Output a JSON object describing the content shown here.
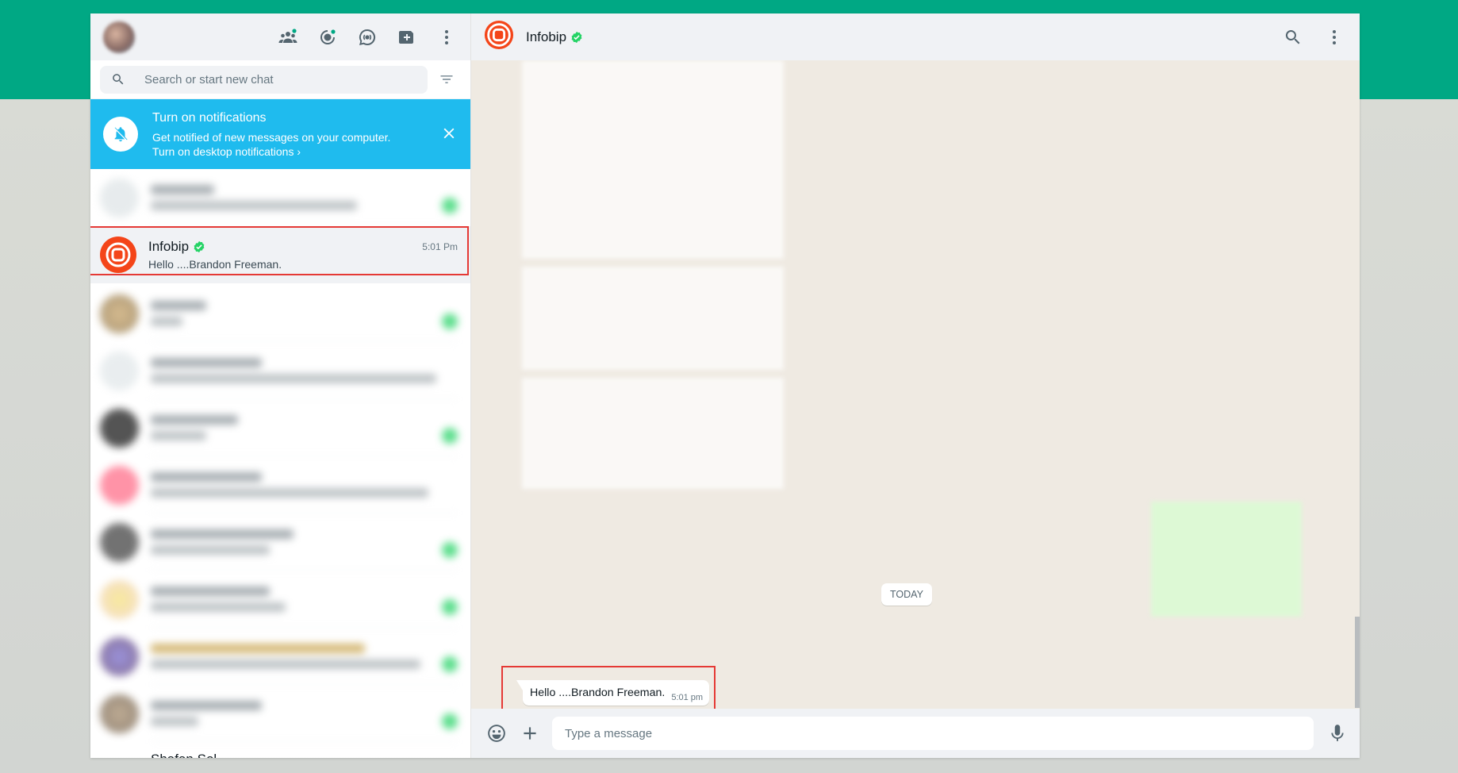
{
  "search": {
    "placeholder": "Search or start new chat"
  },
  "notification": {
    "title": "Turn on notifications",
    "subtitle": "Get notified of new messages on your computer.",
    "link": "Turn on desktop notifications ›"
  },
  "active_chat": {
    "name": "Infobip",
    "last_message": "Hello ....Brandon Freeman.",
    "time": "5:01 Pm"
  },
  "bottom_chat": {
    "name": "Shafan Sol..."
  },
  "conversation": {
    "name": "Infobip",
    "date_chip": "TODAY",
    "message": {
      "text": "Hello ....Brandon Freeman.",
      "time": "5:01 pm"
    }
  },
  "composer": {
    "placeholder": "Type a message"
  },
  "colors": {
    "accent": "#00a884",
    "notification": "#1fbbee",
    "brand": "#f44519",
    "highlight": "#e53935"
  }
}
